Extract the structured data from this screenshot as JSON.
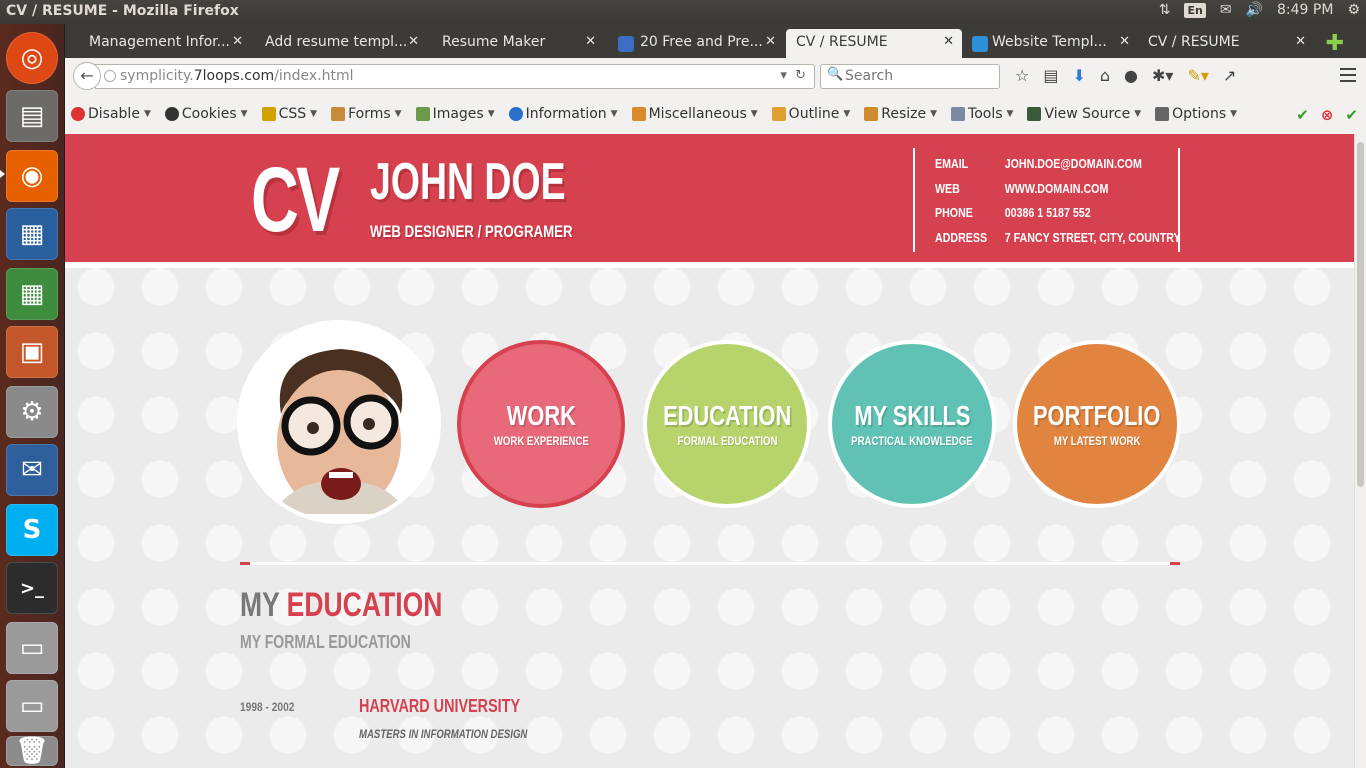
{
  "system": {
    "window_title": "CV / RESUME - Mozilla Firefox",
    "lang": "En",
    "time": "8:49 PM"
  },
  "tabs": [
    {
      "label": "Management Infor...",
      "active": false
    },
    {
      "label": "Add resume templ...",
      "active": false
    },
    {
      "label": "Resume Maker",
      "active": false
    },
    {
      "label": "20 Free and Pre...",
      "active": false
    },
    {
      "label": "CV / RESUME",
      "active": true
    },
    {
      "label": "Website Templ...",
      "active": false
    },
    {
      "label": "CV / RESUME",
      "active": false
    }
  ],
  "navbar": {
    "url_prefix": "symplicity.",
    "url_host": "7loops.com",
    "url_path": "/index.html",
    "search_placeholder": "Search"
  },
  "devbar": {
    "items": [
      "Disable",
      "Cookies",
      "CSS",
      "Forms",
      "Images",
      "Information",
      "Miscellaneous",
      "Outline",
      "Resize",
      "Tools",
      "View Source",
      "Options"
    ]
  },
  "resume": {
    "logo": "CV",
    "name": "JOHN DOE",
    "role": "WEB DESIGNER / PROGRAMER",
    "contact": [
      {
        "key": "EMAIL",
        "value": "JOHN.DOE@DOMAIN.COM"
      },
      {
        "key": "WEB",
        "value": "WWW.DOMAIN.COM"
      },
      {
        "key": "PHONE",
        "value": "00386 1 5187 552"
      },
      {
        "key": "ADDRESS",
        "value": "7 FANCY STREET, CITY, COUNTRY"
      }
    ],
    "circles": [
      {
        "title": "WORK",
        "subtitle": "WORK EXPERIENCE",
        "color": "#e8697a"
      },
      {
        "title": "EDUCATION",
        "subtitle": "FORMAL EDUCATION",
        "color": "#b6d36c"
      },
      {
        "title": "MY SKILLS",
        "subtitle": "PRACTICAL KNOWLEDGE",
        "color": "#5fc2b4"
      },
      {
        "title": "PORTFOLIO",
        "subtitle": "MY LATEST WORK",
        "color": "#e0843f"
      }
    ],
    "section": {
      "title_prefix": "MY",
      "title_accent": "EDUCATION",
      "subtitle": "MY FORMAL EDUCATION",
      "entry": {
        "years": "1998 - 2002",
        "school": "HARVARD UNIVERSITY",
        "degree": "MASTERS IN INFORMATION DESIGN"
      }
    }
  },
  "colors": {
    "accent": "#d6414f",
    "page_bg": "#ebebeb"
  }
}
